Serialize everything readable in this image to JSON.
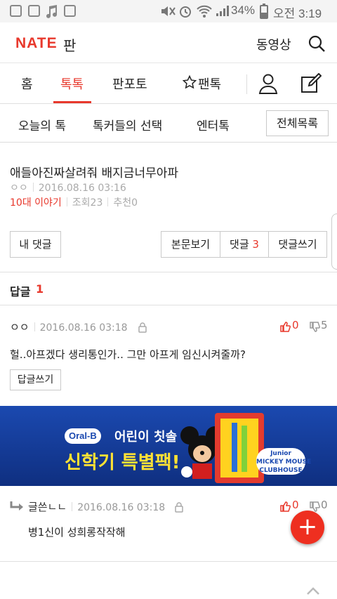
{
  "status_bar": {
    "battery": "34%",
    "time": "오전 3:19"
  },
  "header": {
    "logo": "NATE",
    "logo_sub": "판",
    "video_link": "동영상",
    "icons": [
      "search-icon"
    ]
  },
  "tabs": [
    {
      "label": "홈"
    },
    {
      "label": "톡톡",
      "active": true
    },
    {
      "label": "판포토"
    },
    {
      "label": "팬톡"
    }
  ],
  "subnav": {
    "items": [
      "오늘의 톡",
      "톡커들의 선택",
      "엔터톡"
    ],
    "all_button": "전체목록"
  },
  "post": {
    "title": "애들아진짜살려줘 배지금너무아파",
    "author": "ㅇㅇ",
    "date": "2016.08.16 03:16",
    "category": "10대 이야기",
    "views": "조회23",
    "recommend": "추천0",
    "my_comments_button": "내 댓글",
    "view_body_button": "본문보기",
    "comments_button": "댓글",
    "comments_count": "3",
    "write_comment_button": "댓글쓰기"
  },
  "replies": {
    "label": "답글",
    "count": "1"
  },
  "comments": [
    {
      "author": "ㅇㅇ",
      "date": "2016.08.16 03:18",
      "up": "0",
      "down": "5",
      "text": "헐..아프겠다 생리통인가.. 그만 아프게 임신시켜줄까?",
      "reply_button": "답글쓰기"
    },
    {
      "author": "글쓴ㄴㄴ",
      "date": "2016.08.16 03:18",
      "up": "0",
      "down": "0",
      "text": "병1신이 성희롱작작해"
    }
  ],
  "ad": {
    "brand": "Oral-B",
    "line1": "어린이 칫솔",
    "line2": "신학기 특별팩!",
    "badge": "Junior\nMICKEY MOUSE\nCLUBHOUSE"
  },
  "fab_label": "+",
  "colors": {
    "accent": "#e8382c",
    "ad_bg": "#123a94",
    "ad_yellow": "#ffe234"
  }
}
